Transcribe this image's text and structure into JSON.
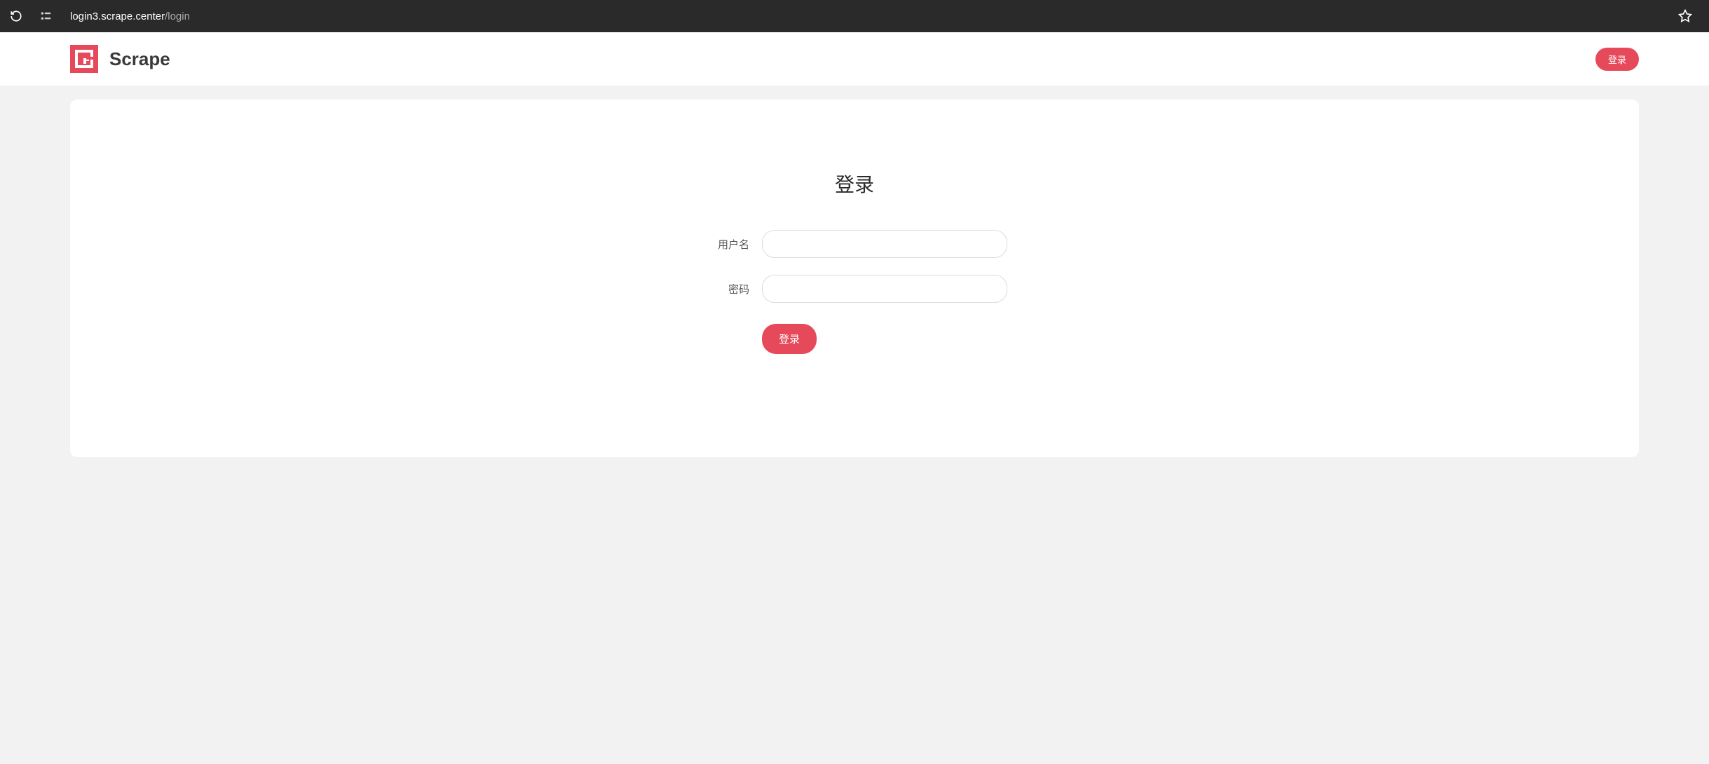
{
  "browser": {
    "url_host": "login3.scrape.center",
    "url_path": "/login"
  },
  "header": {
    "brand_name": "Scrape",
    "login_button": "登录"
  },
  "login": {
    "title": "登录",
    "username_label": "用户名",
    "password_label": "密码",
    "submit_label": "登录"
  },
  "colors": {
    "accent": "#e64a5a",
    "page_bg": "#f2f2f2"
  }
}
